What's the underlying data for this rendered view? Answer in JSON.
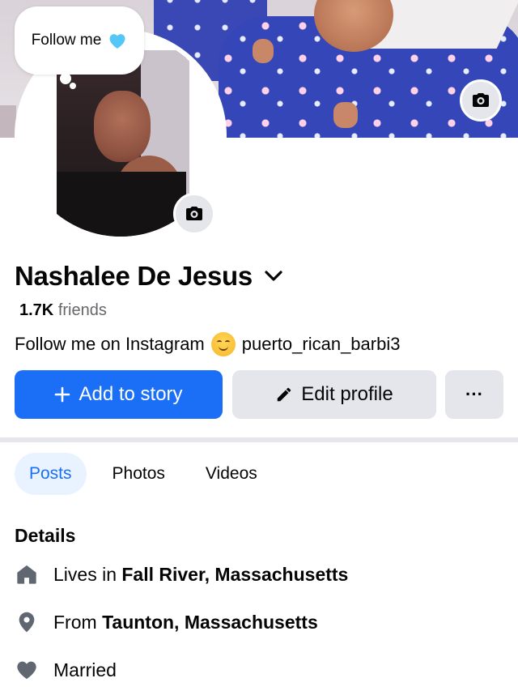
{
  "bubble": {
    "text": "Follow me"
  },
  "profile": {
    "name": "Nashalee De Jesus",
    "friends_count": "1.7K",
    "friends_label": "friends",
    "bio_text": "Follow me on Instagram",
    "bio_handle": "puerto_rican_barbi3"
  },
  "actions": {
    "add_story_label": "Add to story",
    "edit_profile_label": "Edit profile",
    "more_label": "···"
  },
  "tabs": [
    {
      "label": "Posts",
      "active": true
    },
    {
      "label": "Photos",
      "active": false
    },
    {
      "label": "Videos",
      "active": false
    }
  ],
  "details": {
    "title": "Details",
    "lives_prefix": "Lives in",
    "lives_place": "Fall River, Massachusetts",
    "from_prefix": "From",
    "from_place": "Taunton, Massachusetts",
    "relationship": "Married"
  },
  "colors": {
    "primary": "#1b6ff6",
    "secondary_button": "#e4e6eb",
    "muted_text": "#65676b",
    "heart": "#55c7f7"
  },
  "icons": {
    "camera": "camera-icon",
    "chevron": "chevron-down-icon",
    "plus": "plus-icon",
    "pencil": "pencil-icon",
    "home": "home-icon",
    "location": "location-pin-icon",
    "heart": "heart-icon"
  }
}
